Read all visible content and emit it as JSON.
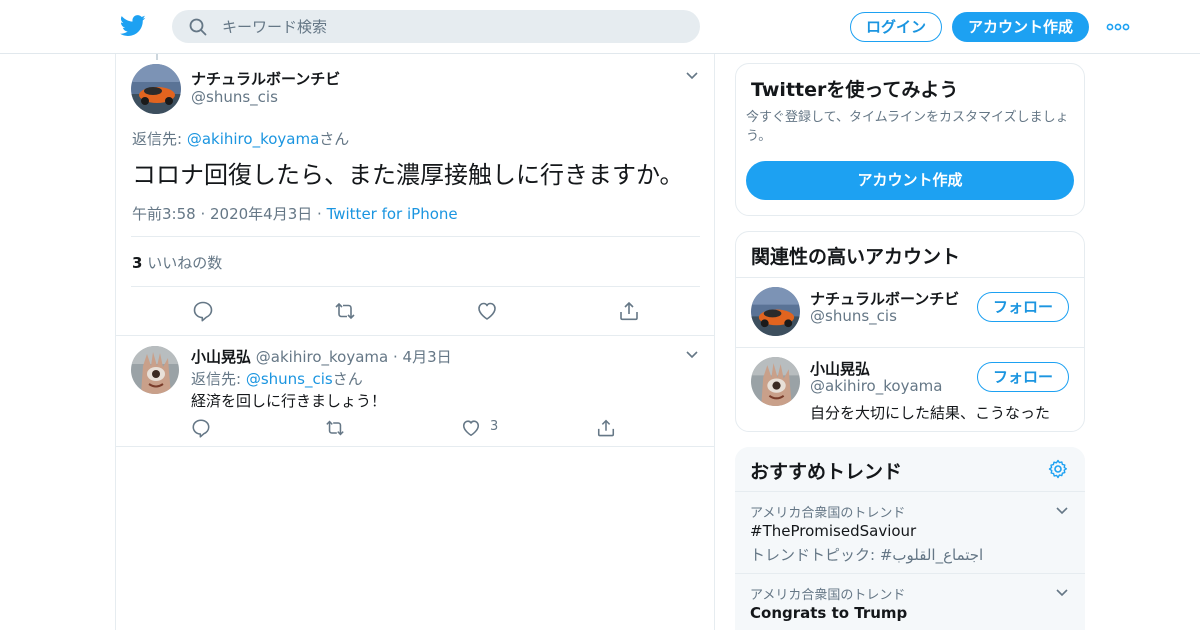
{
  "header": {
    "search_placeholder": "キーワード検索",
    "login_label": "ログイン",
    "signup_label": "アカウント作成"
  },
  "tweet": {
    "author_name": "ナチュラルボーンチビ",
    "author_handle": "@shuns_cis",
    "reply_prefix": "返信先: ",
    "reply_target": "@akihiro_koyama",
    "reply_suffix": "さん",
    "text": "コロナ回復したら、また濃厚接触しに行きますか。",
    "time": "午前3:58 · 2020年4月3日 · ",
    "source": "Twitter for iPhone",
    "like_count": "3",
    "like_label": " いいねの数"
  },
  "reply": {
    "author_name": "小山晃弘",
    "author_handle": "@akihiro_koyama",
    "date": " · 4月3日",
    "reply_prefix": "返信先: ",
    "reply_target": "@shuns_cis",
    "reply_suffix": "さん",
    "text": "経済を回しに行きましょう！",
    "like_count": "3"
  },
  "sidebar": {
    "signup_card": {
      "title": "Twitterを使ってみよう",
      "description": "今すぐ登録して、タイムラインをカスタマイズしましょう。",
      "button_label": "アカウント作成"
    },
    "related": {
      "title": "関連性の高いアカウント",
      "accounts": [
        {
          "name": "ナチュラルボーンチビ",
          "handle": "@shuns_cis",
          "bio": "",
          "follow_label": "フォロー"
        },
        {
          "name": "小山晃弘",
          "handle": "@akihiro_koyama",
          "bio": "自分を大切にした結果、こうなった",
          "follow_label": "フォロー"
        }
      ]
    },
    "trends": {
      "title": "おすすめトレンド",
      "items": [
        {
          "context": "アメリカ合衆国のトレンド",
          "name": "#ThePromisedSaviour",
          "subtitle": "トレンドトピック: #اجتماع_القلوب"
        },
        {
          "context": "アメリカ合衆国のトレンド",
          "name": "Congrats to Trump",
          "subtitle": ""
        }
      ]
    }
  },
  "colors": {
    "brand_blue": "#1da1f2",
    "link_blue": "#1b95e0",
    "secondary_text": "#657786",
    "border": "#e6ecf0"
  },
  "icons": [
    "twitter-logo-icon",
    "search-icon",
    "more-icon",
    "chevron-down-icon",
    "reply-icon",
    "retweet-icon",
    "like-icon",
    "share-icon",
    "gear-icon"
  ]
}
